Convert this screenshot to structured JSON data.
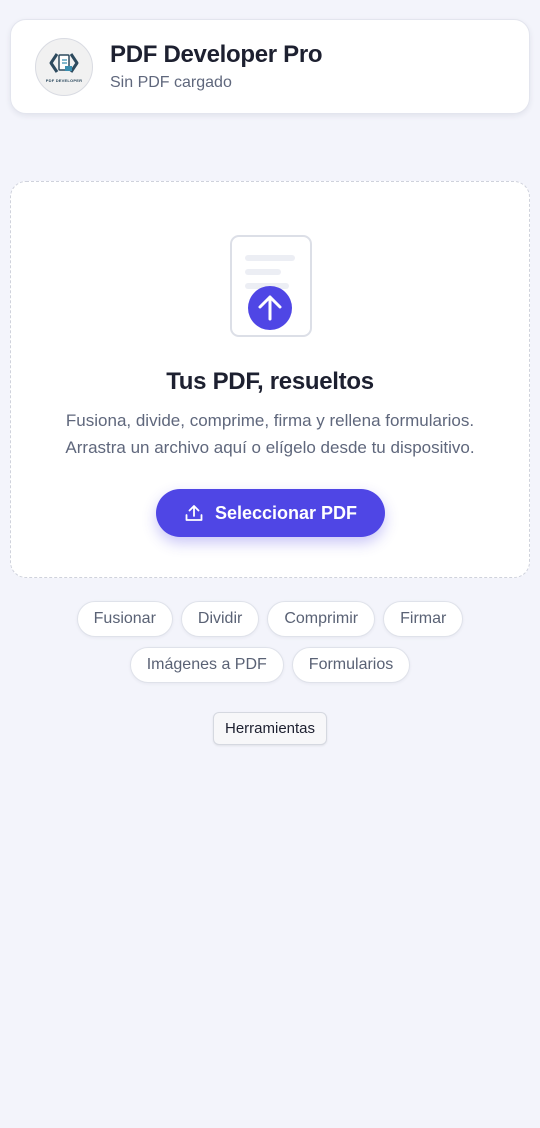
{
  "header": {
    "title": "PDF Developer Pro",
    "subtitle": "Sin PDF cargado",
    "logo_caption": "PDF DEVELOPER"
  },
  "dropzone": {
    "icon": "upload-document-icon",
    "title": "Tus PDF, resueltos",
    "description_line1": "Fusiona, divide, comprime, firma y rellena formularios.",
    "description_line2": "Arrastra un archivo aquí o elígelo desde tu dispositivo.",
    "select_button_label": "Seleccionar PDF"
  },
  "chips": {
    "row1": [
      "Fusionar",
      "Dividir",
      "Comprimir",
      "Firmar"
    ],
    "row2": [
      "Imágenes a PDF",
      "Formularios"
    ]
  },
  "tools_button_label": "Herramientas",
  "colors": {
    "accent": "#4f46e5",
    "background": "#f3f4fb",
    "text_primary": "#1d2030",
    "text_secondary": "#5f677c"
  }
}
